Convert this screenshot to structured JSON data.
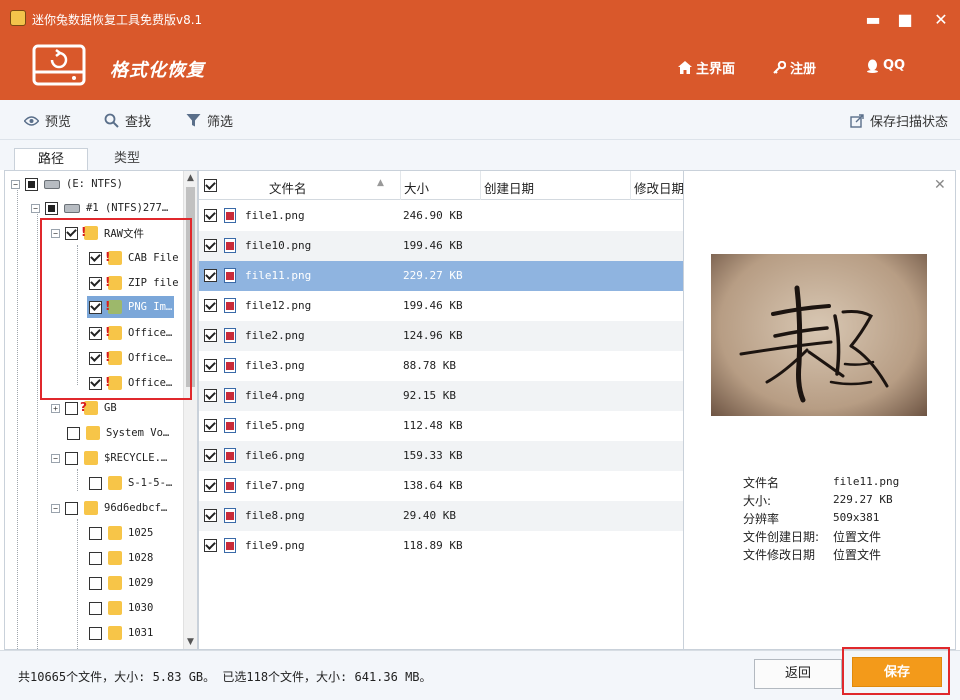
{
  "window": {
    "title": "迷你兔数据恢复工具免费版v8.1",
    "min_glyph": "▬",
    "max_glyph": "■",
    "close_glyph": "✕"
  },
  "header": {
    "mode_title": "格式化恢复",
    "nav": {
      "home": "主界面",
      "register": "注册",
      "qq": "QQ"
    },
    "bg_color": "#d9582b"
  },
  "toolbar": {
    "preview": "预览",
    "find": "查找",
    "filter": "筛选",
    "save_scan_state": "保存扫描状态"
  },
  "tabs": {
    "path": "路径",
    "type": "类型"
  },
  "tree": {
    "items": [
      {
        "label": "(E: NTFS)",
        "state": "partial",
        "icon": "drive-icon"
      },
      {
        "label": "#1 (NTFS)277…",
        "state": "partial",
        "icon": "drive-icon"
      },
      {
        "label": "RAW文件",
        "state": "checked",
        "icon": "folder-warn-icon"
      },
      {
        "label": "CAB File",
        "state": "checked",
        "icon": "folder-warn-icon"
      },
      {
        "label": "ZIP file",
        "state": "checked",
        "icon": "folder-warn-icon"
      },
      {
        "label": "PNG Im…",
        "state": "checked",
        "icon": "folder-warn-icon"
      },
      {
        "label": "Office…",
        "state": "checked",
        "icon": "folder-warn-icon"
      },
      {
        "label": "Office…",
        "state": "checked",
        "icon": "folder-warn-icon"
      },
      {
        "label": "Office…",
        "state": "checked",
        "icon": "folder-warn-icon"
      },
      {
        "label": "GB",
        "state": "unchecked",
        "icon": "folder-unknown-icon"
      },
      {
        "label": "System Vo…",
        "state": "unchecked",
        "icon": "folder-icon"
      },
      {
        "label": "$RECYCLE.…",
        "state": "unchecked",
        "icon": "folder-icon"
      },
      {
        "label": "S-1-5-…",
        "state": "unchecked",
        "icon": "folder-icon"
      },
      {
        "label": "96d6edbcf…",
        "state": "unchecked",
        "icon": "folder-icon"
      },
      {
        "label": "1025",
        "state": "unchecked",
        "icon": "folder-icon"
      },
      {
        "label": "1028",
        "state": "unchecked",
        "icon": "folder-icon"
      },
      {
        "label": "1029",
        "state": "unchecked",
        "icon": "folder-icon"
      },
      {
        "label": "1030",
        "state": "unchecked",
        "icon": "folder-icon"
      },
      {
        "label": "1031",
        "state": "unchecked",
        "icon": "folder-icon"
      }
    ]
  },
  "file_list": {
    "columns": {
      "name": "文件名",
      "size": "大小",
      "created": "创建日期",
      "modified": "修改日期"
    },
    "rows": [
      {
        "name": "file1.png",
        "size": "246.90 KB"
      },
      {
        "name": "file10.png",
        "size": "199.46 KB"
      },
      {
        "name": "file11.png",
        "size": "229.27 KB"
      },
      {
        "name": "file12.png",
        "size": "199.46 KB"
      },
      {
        "name": "file2.png",
        "size": "124.96 KB"
      },
      {
        "name": "file3.png",
        "size": "88.78 KB"
      },
      {
        "name": "file4.png",
        "size": "92.15 KB"
      },
      {
        "name": "file5.png",
        "size": "112.48 KB"
      },
      {
        "name": "file6.png",
        "size": "159.33 KB"
      },
      {
        "name": "file7.png",
        "size": "138.64 KB"
      },
      {
        "name": "file8.png",
        "size": "29.40 KB"
      },
      {
        "name": "file9.png",
        "size": "118.89 KB"
      }
    ],
    "selected_index": 2
  },
  "preview": {
    "close_glyph": "✕",
    "info": [
      {
        "label": "文件名",
        "value": "file11.png"
      },
      {
        "label": "大小:",
        "value": "229.27 KB"
      },
      {
        "label": "分辨率",
        "value": "509x381"
      },
      {
        "label": "文件创建日期:",
        "value": "位置文件"
      },
      {
        "label": "文件修改日期",
        "value": "位置文件"
      }
    ]
  },
  "status": {
    "text": "共10665个文件，大小: 5.83 GB。 已选118个文件，大小: 641.36 MB。",
    "back": "返回",
    "save": "保存"
  }
}
